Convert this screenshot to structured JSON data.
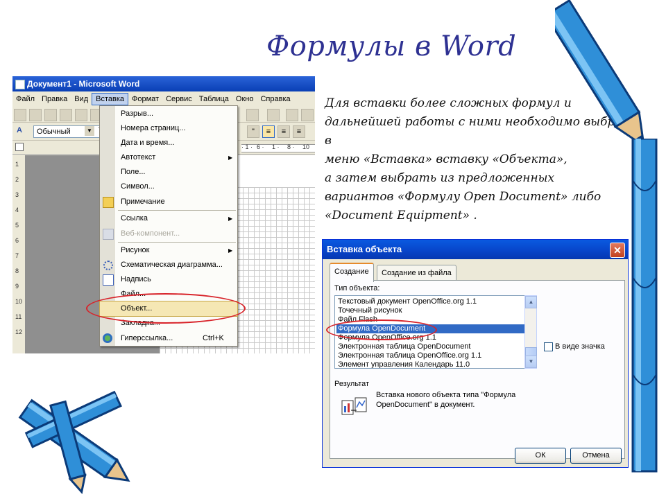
{
  "slide": {
    "title": "Формулы в Word",
    "body_lines": [
      "Для вставки более сложных формул и",
      "дальнейшей работы с ними необходимо выбрать",
      "в",
      "меню «Вставка» вставку «Объекта»,",
      "а затем выбрать из предложенных",
      "вариантов «Формулу Open Document» либо",
      "«Document Equipment» ."
    ]
  },
  "word": {
    "window_title": "Документ1 - Microsoft Word",
    "menubar": [
      "Файл",
      "Правка",
      "Вид",
      "Вставка",
      "Формат",
      "Сервис",
      "Таблица",
      "Окно",
      "Справка"
    ],
    "active_menu": "Вставка",
    "style_value": "Обычный",
    "font_fragment": "T",
    "ruler_marks": [
      "· 1 ·",
      "6 ·",
      "1 ·",
      "8 ·",
      "10"
    ],
    "vruler_marks": [
      "1",
      "2",
      "3",
      "4",
      "5",
      "6",
      "7",
      "8",
      "9",
      "10",
      "11",
      "12"
    ],
    "insert_menu": [
      {
        "label": "Разрыв...",
        "icon": "",
        "submenu": false,
        "disabled": false
      },
      {
        "label": "Номера страниц...",
        "icon": "",
        "submenu": false,
        "disabled": false
      },
      {
        "label": "Дата и время...",
        "icon": "",
        "submenu": false,
        "disabled": false
      },
      {
        "label": "Автотекст",
        "icon": "",
        "submenu": true,
        "disabled": false
      },
      {
        "label": "Поле...",
        "icon": "",
        "submenu": false,
        "disabled": false
      },
      {
        "label": "Символ...",
        "icon": "",
        "submenu": false,
        "disabled": false
      },
      {
        "label": "Примечание",
        "icon": "note-icon",
        "submenu": false,
        "disabled": false
      },
      {
        "label": "Ссылка",
        "icon": "",
        "submenu": true,
        "disabled": false
      },
      {
        "label": "Веб-компонент...",
        "icon": "web-component-icon",
        "submenu": false,
        "disabled": true
      },
      {
        "label": "Рисунок",
        "icon": "",
        "submenu": true,
        "disabled": false
      },
      {
        "label": "Схематическая диаграмма...",
        "icon": "diagram-icon",
        "submenu": false,
        "disabled": false
      },
      {
        "label": "Надпись",
        "icon": "textbox-icon",
        "submenu": false,
        "disabled": false
      },
      {
        "label": "Файл...",
        "icon": "",
        "submenu": false,
        "disabled": false
      },
      {
        "label": "Объект...",
        "icon": "",
        "submenu": false,
        "disabled": false,
        "highlighted": true
      },
      {
        "label": "Закладка...",
        "icon": "",
        "submenu": false,
        "disabled": false
      },
      {
        "label": "Гиперссылка...",
        "icon": "hyperlink-icon",
        "submenu": false,
        "disabled": false,
        "shortcut": "Ctrl+K"
      }
    ]
  },
  "dialog": {
    "title": "Вставка объекта",
    "close_label": "✕",
    "tabs": [
      "Создание",
      "Создание из файла"
    ],
    "active_tab": "Создание",
    "type_label": "Тип объекта:",
    "object_types": [
      "Текстовый документ OpenOffice.org 1.1",
      "Точечный рисунок",
      "Файл Flash",
      "Формула OpenDocument",
      "Формула OpenOffice.org 1.1",
      "Электронная таблица OpenDocument",
      "Электронная таблица OpenOffice.org 1.1",
      "Элемент управления Календарь 11.0"
    ],
    "selected_type": "Формула OpenDocument",
    "as_icon_label": "В виде значка",
    "as_icon_checked": false,
    "result_label": "Результат",
    "result_text_lines": [
      "Вставка нового объекта типа \"Формула",
      "OpenDocument\" в документ."
    ],
    "ok_label": "ОК",
    "cancel_label": "Отмена"
  },
  "colors": {
    "title": "#2e3192",
    "highlight_oval": "#d8232a",
    "xp_titlebar": "#0a5ae0",
    "pencil_body": "#2f8fd8"
  }
}
